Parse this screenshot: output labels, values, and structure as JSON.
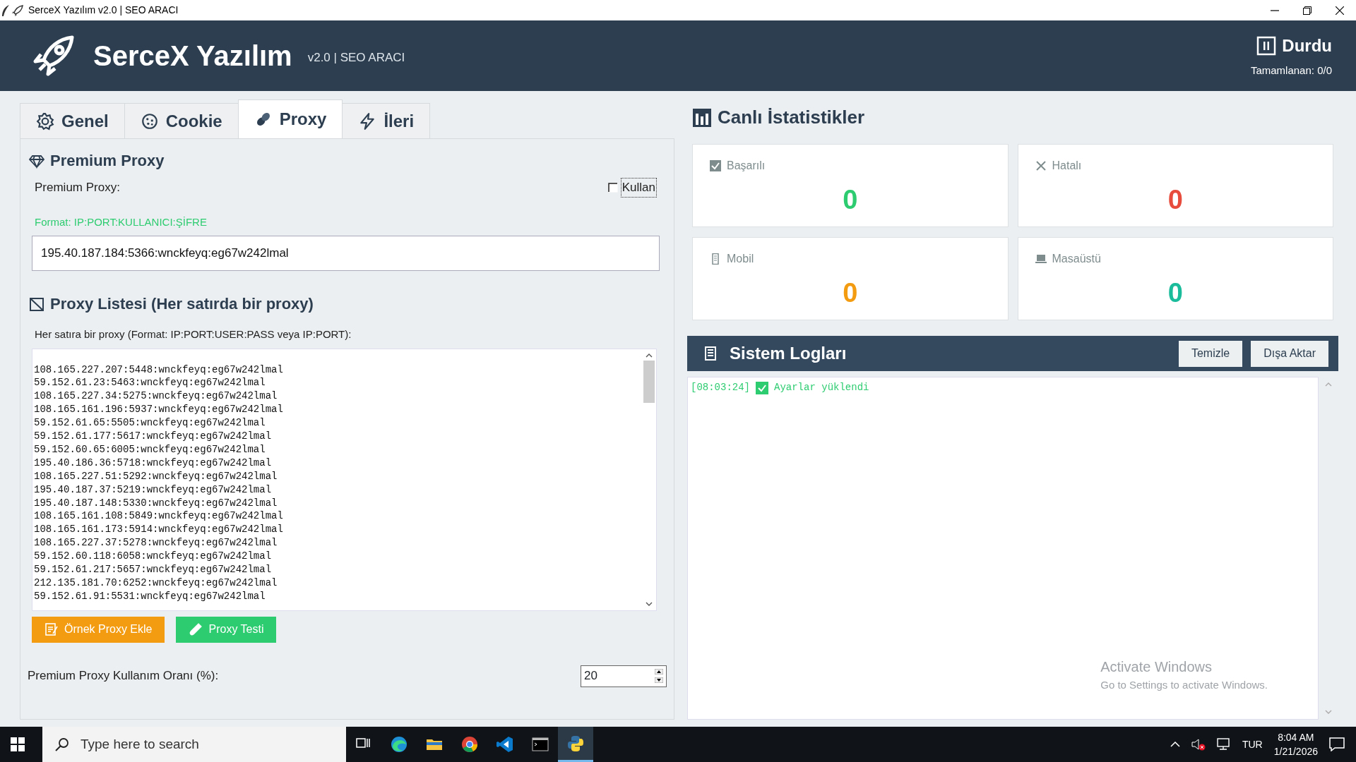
{
  "window": {
    "title": "SerceX Yazılım v2.0 | SEO ARACI"
  },
  "header": {
    "app_name": "SerceX Yazılım",
    "version": "v2.0 | SEO ARACI",
    "status": "Durdu",
    "progress": "Tamamlanan: 0/0"
  },
  "tabs": [
    {
      "label": "Genel",
      "kind": "gear",
      "selected": false
    },
    {
      "label": "Cookie",
      "kind": "cookie",
      "selected": false
    },
    {
      "label": "Proxy",
      "kind": "link",
      "selected": true
    },
    {
      "label": "İleri",
      "kind": "bolt",
      "selected": false
    }
  ],
  "premium_proxy": {
    "title": "Premium Proxy",
    "label": "Premium Proxy:",
    "use_checkbox": {
      "label": "Kullan",
      "checked": false
    },
    "format_hint": "Format: IP:PORT:KULLANICI:ŞİFRE",
    "value": "195.40.187.184:5366:wnckfeyq:eg67w242lmal"
  },
  "proxy_list": {
    "title": "Proxy Listesi (Her satırda bir proxy)",
    "hint": "Her satıra bir proxy (Format: IP:PORT:USER:PASS veya IP:PORT):",
    "lines": [
      "108.165.227.207:5448:wnckfeyq:eg67w242lmal",
      "59.152.61.23:5463:wnckfeyq:eg67w242lmal",
      "108.165.227.34:5275:wnckfeyq:eg67w242lmal",
      "108.165.161.196:5937:wnckfeyq:eg67w242lmal",
      "59.152.61.65:5505:wnckfeyq:eg67w242lmal",
      "59.152.61.177:5617:wnckfeyq:eg67w242lmal",
      "59.152.60.65:6005:wnckfeyq:eg67w242lmal",
      "195.40.186.36:5718:wnckfeyq:eg67w242lmal",
      "108.165.227.51:5292:wnckfeyq:eg67w242lmal",
      "195.40.187.37:5219:wnckfeyq:eg67w242lmal",
      "195.40.187.148:5330:wnckfeyq:eg67w242lmal",
      "108.165.161.108:5849:wnckfeyq:eg67w242lmal",
      "108.165.161.173:5914:wnckfeyq:eg67w242lmal",
      "108.165.227.37:5278:wnckfeyq:eg67w242lmal",
      "59.152.60.118:6058:wnckfeyq:eg67w242lmal",
      "59.152.61.217:5657:wnckfeyq:eg67w242lmal",
      "212.135.181.70:6252:wnckfeyq:eg67w242lmal",
      "59.152.61.91:5531:wnckfeyq:eg67w242lmal"
    ]
  },
  "buttons": [
    {
      "label": "Örnek Proxy Ekle",
      "kind": "sample"
    },
    {
      "label": "Proxy Testi",
      "kind": "test"
    }
  ],
  "usage_ratio": {
    "label": "Premium Proxy Kullanım Oranı (%):",
    "value": "20"
  },
  "stats": {
    "title": "Canlı İstatistikler",
    "cards": [
      {
        "label": "Başarılı",
        "value": "0",
        "kind": "success",
        "color": "#2ecc71"
      },
      {
        "label": "Hatalı",
        "value": "0",
        "kind": "error",
        "color": "#e74c3c"
      },
      {
        "label": "Mobil",
        "value": "0",
        "kind": "mobile",
        "color": "#f39c12"
      },
      {
        "label": "Masaüstü",
        "value": "0",
        "kind": "desktop",
        "color": "#1abc9c"
      }
    ]
  },
  "logs": {
    "title": "Sistem Logları",
    "buttons": [
      "Temizle",
      "Dışa Aktar"
    ],
    "entries": [
      {
        "time": "[08:03:24]",
        "message": "Ayarlar yüklendi",
        "kind": "ok"
      }
    ]
  },
  "watermark": {
    "title": "Activate Windows",
    "subtitle": "Go to Settings to activate Windows."
  },
  "taskbar": {
    "search_placeholder": "Type here to search",
    "language": "TUR",
    "time": "8:04 AM",
    "date": "1/21/2026"
  }
}
